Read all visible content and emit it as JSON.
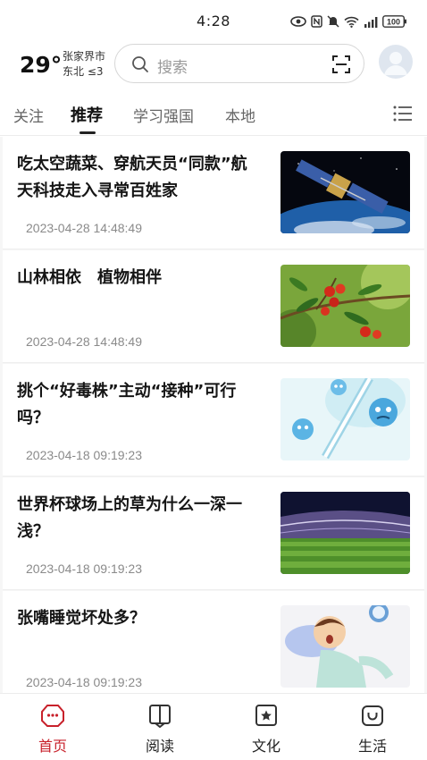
{
  "status_bar": {
    "time": "4:28",
    "battery": "100"
  },
  "weather": {
    "temperature": "29°",
    "city": "张家界市",
    "wind": "东北  ≤3"
  },
  "search": {
    "placeholder": "搜索"
  },
  "tabs": [
    {
      "label": "关注"
    },
    {
      "label": "推荐"
    },
    {
      "label": "学习强国"
    },
    {
      "label": "本地"
    }
  ],
  "articles": [
    {
      "title": "吃太空蔬菜、穿航天员“同款”航天科技走入寻常百姓家",
      "time": "2023-04-28 14:48:49",
      "image": "satellite-over-earth"
    },
    {
      "title": "山林相依　植物相伴",
      "time": "2023-04-28 14:48:49",
      "image": "red-berries-on-branch"
    },
    {
      "title": "挑个“好毒株”主动“接种”可行吗？",
      "time": "2023-04-18 09:19:23",
      "image": "cartoon-virus-and-syringe"
    },
    {
      "title": "世界杯球场上的草为什么一深一浅？",
      "time": "2023-04-18 09:19:23",
      "image": "football-stadium"
    },
    {
      "title": "张嘴睡觉坏处多？",
      "time": "2023-04-18 09:19:23",
      "image": "cartoon-sleeping-boy"
    }
  ],
  "bottom_nav": [
    {
      "label": "首页",
      "icon": "home-icon"
    },
    {
      "label": "阅读",
      "icon": "book-icon"
    },
    {
      "label": "文化",
      "icon": "star-icon"
    },
    {
      "label": "生活",
      "icon": "smile-bag-icon"
    }
  ],
  "colors": {
    "accent": "#c8212b",
    "text": "#151515",
    "muted": "#8a8a8a"
  }
}
